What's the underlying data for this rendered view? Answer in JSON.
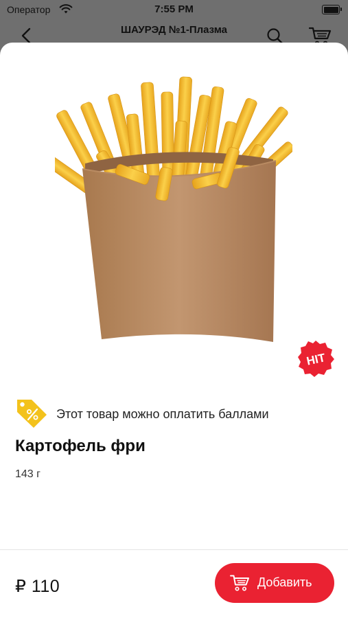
{
  "status_bar": {
    "carrier": "Оператор",
    "time": "7:55 PM"
  },
  "nav": {
    "title": "ШАУРЭД №1-Плазма"
  },
  "product": {
    "badge": "HIT",
    "points_notice": "Этот товар можно оплатить баллами",
    "name": "Картофель фри",
    "weight": "143 г",
    "price": "₽ 110",
    "add_button_label": "Добавить"
  },
  "colors": {
    "accent": "#ea2232",
    "points_tag": "#f3c21c",
    "dimmed_background": "#6f6f6f"
  },
  "icons": {
    "back": "chevron-left-icon",
    "search": "search-icon",
    "cart": "cart-icon",
    "points": "percent-tag-icon",
    "wifi": "wifi-icon",
    "battery": "battery-icon"
  }
}
